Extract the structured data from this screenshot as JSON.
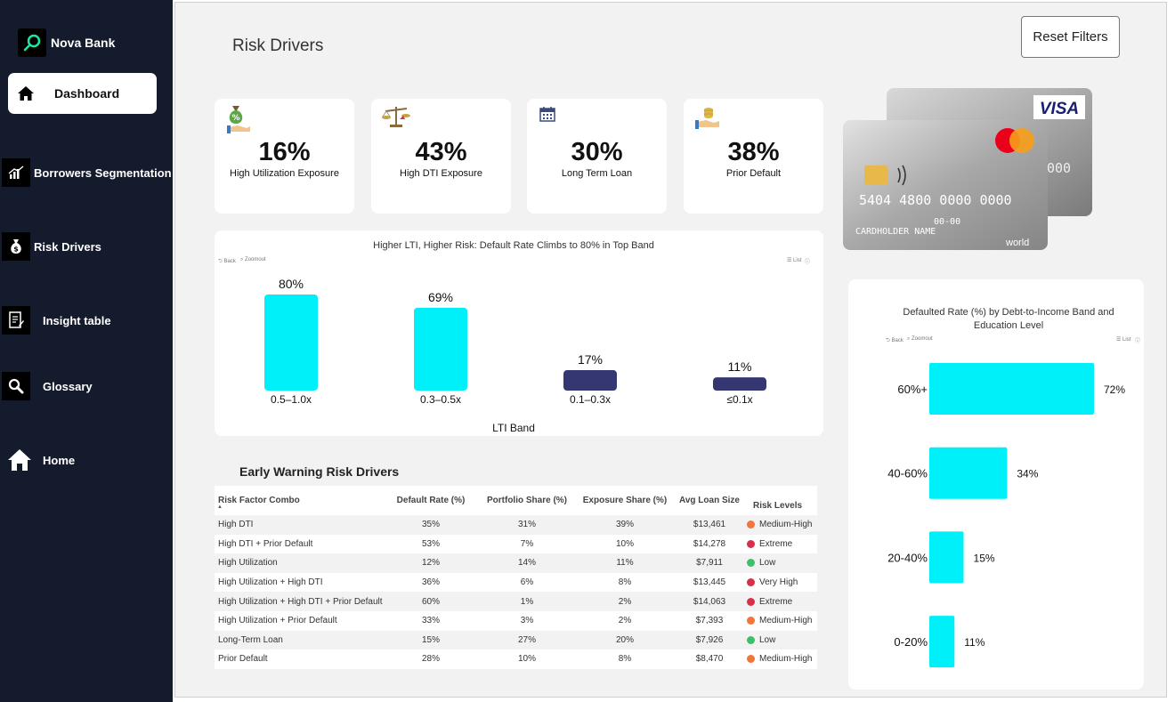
{
  "brand": {
    "name": "Nova Bank"
  },
  "nav": [
    {
      "label": "Dashboard",
      "icon": "home-icon",
      "active": true
    },
    {
      "label": "Borrowers Segmentation",
      "icon": "bar-chart-icon"
    },
    {
      "label": "Risk Drivers",
      "icon": "money-bag-icon"
    },
    {
      "label": "Insight table",
      "icon": "document-icon"
    },
    {
      "label": "Glossary",
      "icon": "search-icon"
    },
    {
      "label": "Home",
      "icon": "home-icon"
    }
  ],
  "page": {
    "title": "Risk Drivers",
    "reset_label": "Reset Filters"
  },
  "kpis": [
    {
      "value": "16%",
      "label": "High Utilization Exposure",
      "icon": "money-hand-icon"
    },
    {
      "value": "43%",
      "label": "High DTI Exposure",
      "icon": "scale-icon"
    },
    {
      "value": "30%",
      "label": "Long Term Loan",
      "icon": "calendar-icon"
    },
    {
      "value": "38%",
      "label": "Prior Default",
      "icon": "coins-hand-icon"
    }
  ],
  "card_image": {
    "number": "5404 4800 0000 0000",
    "holder": "CARDHOLDER NAME",
    "valid": "00-00",
    "brand1": "VISA",
    "brand2": "world",
    "partial": "000"
  },
  "controls": {
    "back": "Back",
    "zoom": "Zoomout",
    "list": "List",
    "help": "?"
  },
  "chart_data": [
    {
      "type": "bar",
      "title": "Higher LTI, Higher Risk: Default Rate Climbs to 80% in Top Band",
      "xlabel": "LTI Band",
      "categories": [
        "0.5–1.0x",
        "0.3–0.5x",
        "0.1–0.3x",
        "≤0.1x"
      ],
      "values": [
        80,
        69,
        17,
        11
      ],
      "data_labels": [
        "80%",
        "69%",
        "17%",
        "11%"
      ],
      "colors": [
        "#00f0fa",
        "#00f0fa",
        "#353772",
        "#353772"
      ],
      "ylim": [
        0,
        80
      ]
    },
    {
      "type": "bar",
      "orientation": "horizontal",
      "title": "Defaulted Rate (%) by Debt-to-Income Band and Education Level",
      "categories": [
        "60%+",
        "40-60%",
        "20-40%",
        "0-20%"
      ],
      "values": [
        72,
        34,
        15,
        11
      ],
      "data_labels": [
        "72%",
        "34%",
        "15%",
        "11%"
      ],
      "colors": [
        "#00f0fa",
        "#00f0fa",
        "#00f0fa",
        "#00f0fa"
      ],
      "xlim": [
        0,
        72
      ]
    }
  ],
  "table": {
    "title": "Early Warning Risk Drivers",
    "headers": [
      "Risk Factor Combo",
      "Default Rate (%)",
      "Portfolio Share (%)",
      "Exposure Share (%)",
      "Avg Loan Size",
      "Risk Levels"
    ],
    "sort_indicator": "▲",
    "rows": [
      [
        "High DTI",
        "35%",
        "31%",
        "39%",
        "$13,461",
        "Medium-High"
      ],
      [
        "High DTI + Prior Default",
        "53%",
        "7%",
        "10%",
        "$14,278",
        "Extreme"
      ],
      [
        "High Utilization",
        "12%",
        "14%",
        "11%",
        "$7,911",
        "Low"
      ],
      [
        "High Utilization + High DTI",
        "36%",
        "6%",
        "8%",
        "$13,445",
        "Very High"
      ],
      [
        "High Utilization + High DTI + Prior Default",
        "60%",
        "1%",
        "2%",
        "$14,063",
        "Extreme"
      ],
      [
        "High Utilization + Prior Default",
        "33%",
        "3%",
        "2%",
        "$7,393",
        "Medium-High"
      ],
      [
        "Long-Term Loan",
        "15%",
        "27%",
        "20%",
        "$7,926",
        "Low"
      ],
      [
        "Prior Default",
        "28%",
        "10%",
        "8%",
        "$8,470",
        "Medium-High"
      ]
    ],
    "risk_colors": {
      "Medium-High": "#f2753a",
      "Extreme": "#d9304a",
      "Low": "#3fbf6a",
      "Very High": "#d9304a"
    },
    "row_colors": [
      "#f2f2f2",
      "#ffffff"
    ]
  }
}
